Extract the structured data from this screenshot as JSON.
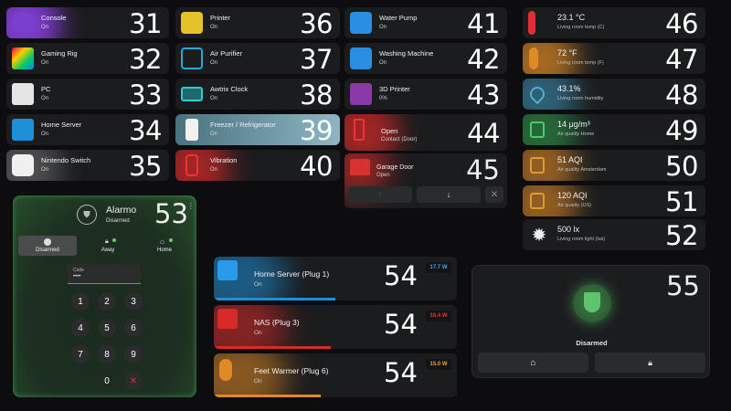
{
  "colors": {
    "purple": "#7b3fcf",
    "green": "#2f9a4c",
    "blue": "#1e8fd6",
    "yellow": "#e5c22a",
    "red": "#d92a2a",
    "orange": "#e08a25",
    "teal": "#3d8fb0",
    "pink": "#a03bb8"
  },
  "column1": [
    {
      "name": "Console",
      "state": "On",
      "num": "31",
      "icon": "gamepad-icon"
    },
    {
      "name": "Gaming Rig",
      "state": "On",
      "num": "32",
      "icon": "desktop-tower-icon"
    },
    {
      "name": "PC",
      "state": "On",
      "num": "33",
      "icon": "desktop-tower-icon"
    },
    {
      "name": "Home Server",
      "state": "On",
      "num": "34",
      "icon": "server-icon"
    },
    {
      "name": "Nintendo Switch",
      "state": "On",
      "num": "35",
      "icon": "nintendo-switch-icon"
    }
  ],
  "column2": [
    {
      "name": "Printer",
      "state": "On",
      "num": "36",
      "icon": "printer-icon"
    },
    {
      "name": "Air Purifier",
      "state": "On",
      "num": "37",
      "icon": "air-purifier-icon"
    },
    {
      "name": "Awtrix Clock",
      "state": "On",
      "num": "38",
      "icon": "clock-display-icon"
    },
    {
      "name": "Freezer / Refrigerator",
      "state": "On",
      "num": "39",
      "icon": "fridge-icon"
    },
    {
      "name": "Vibration",
      "state": "On",
      "num": "40",
      "icon": "vibration-icon"
    }
  ],
  "column3": [
    {
      "name": "Water Pump",
      "state": "On",
      "num": "41",
      "icon": "water-pump-icon"
    },
    {
      "name": "Washing Machine",
      "state": "On",
      "num": "42",
      "icon": "washing-machine-icon"
    },
    {
      "name": "3D Printer",
      "state": "0%",
      "num": "43",
      "icon": "3d-printer-icon"
    },
    {
      "name": "Open",
      "state": "Contact (Door)",
      "num": "44",
      "icon": "door-open-icon"
    },
    {
      "name": "Garage Door",
      "state": "Open",
      "num": "45",
      "icon": "garage-door-icon"
    }
  ],
  "sensors": [
    {
      "name": "23.1 °C",
      "state": "Living room temp (C)",
      "num": "46",
      "icon": "thermometer-icon"
    },
    {
      "name": "72 °F",
      "state": "Living room temp (F)",
      "num": "47",
      "icon": "thermometer-icon"
    },
    {
      "name": "43.1%",
      "state": "Living room humidity",
      "num": "48",
      "icon": "water-drop-icon"
    },
    {
      "name": "14 µg/m³",
      "state": "Air quality Home",
      "num": "49",
      "icon": "air-filter-icon"
    },
    {
      "name": "51 AQI",
      "state": "Air quality Amsterdam",
      "num": "50",
      "icon": "air-filter-icon"
    },
    {
      "name": "120 AQI",
      "state": "Air quality (US)",
      "num": "51",
      "icon": "air-filter-icon"
    },
    {
      "name": "500 lx",
      "state": "Living room light (lux)",
      "num": "52",
      "icon": "brightness-icon"
    }
  ],
  "alarmo": {
    "title": "Alarmo",
    "state": "Disarmed",
    "num": "53",
    "tabs": [
      "Disarmed",
      "Away",
      "Home"
    ],
    "code_label": "Code",
    "code_value": "••••",
    "keys": [
      "1",
      "2",
      "3",
      "4",
      "5",
      "6",
      "7",
      "8",
      "9",
      "0"
    ]
  },
  "plugs": [
    {
      "name": "Home Server (Plug 1)",
      "state": "On",
      "num": "54",
      "watt": "17.7 W",
      "level": 0.5
    },
    {
      "name": "NAS (Plug 3)",
      "state": "On",
      "num": "54",
      "watt": "16.4 W",
      "level": 0.48
    },
    {
      "name": "Feet Warmer (Plug 6)",
      "state": "On",
      "num": "54",
      "watt": "15.0 W",
      "level": 0.44
    }
  ],
  "alarm2": {
    "num": "55",
    "state": "Disarmed"
  }
}
